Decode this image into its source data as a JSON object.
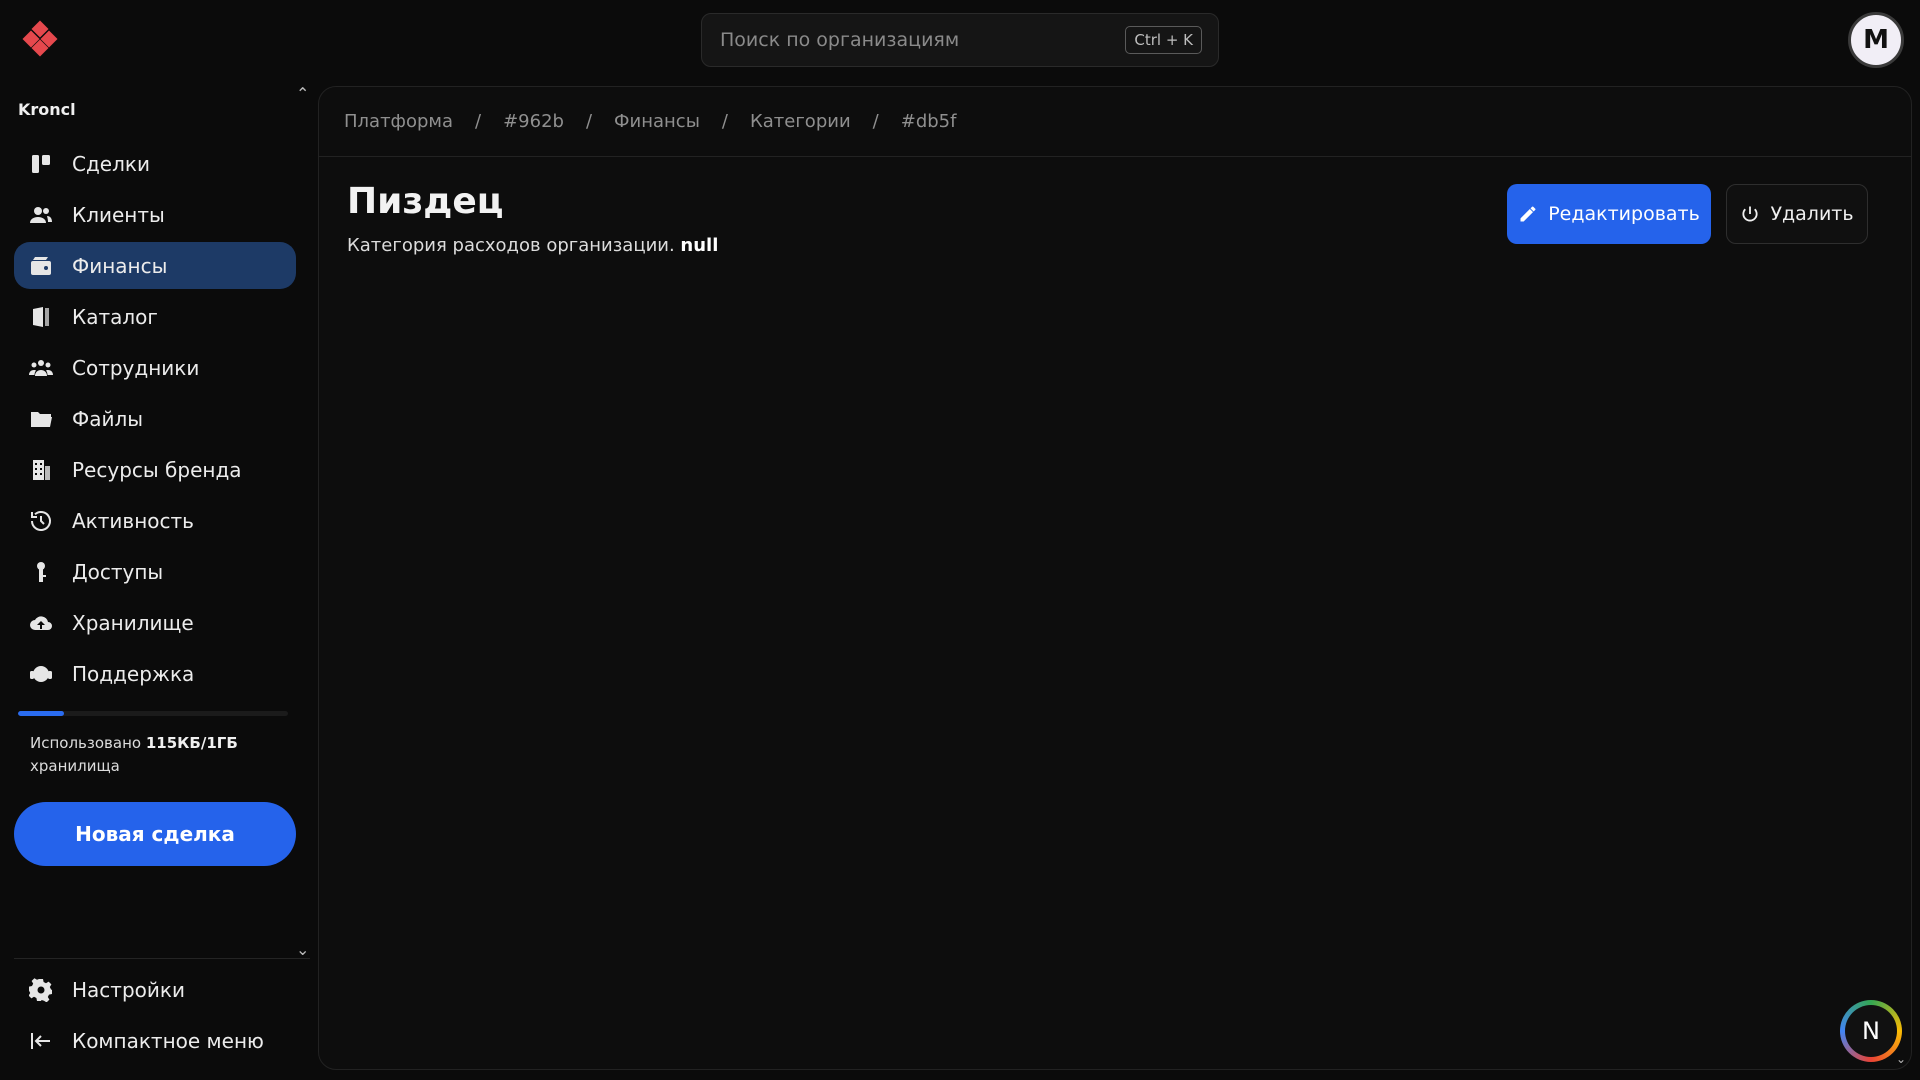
{
  "search": {
    "placeholder": "Поиск по организациям",
    "shortcut": "Ctrl + K"
  },
  "user": {
    "avatar_letter": "M"
  },
  "sidebar": {
    "org_name": "Kroncl",
    "items": [
      {
        "label": "Сделки",
        "icon": "kanban-icon",
        "active": false
      },
      {
        "label": "Клиенты",
        "icon": "users-icon",
        "active": false
      },
      {
        "label": "Финансы",
        "icon": "wallet-icon",
        "active": true
      },
      {
        "label": "Каталог",
        "icon": "catalog-icon",
        "active": false
      },
      {
        "label": "Сотрудники",
        "icon": "team-icon",
        "active": false
      },
      {
        "label": "Файлы",
        "icon": "folder-icon",
        "active": false
      },
      {
        "label": "Ресурсы бренда",
        "icon": "building-icon",
        "active": false
      },
      {
        "label": "Активность",
        "icon": "history-icon",
        "active": false
      },
      {
        "label": "Доступы",
        "icon": "key-icon",
        "active": false
      },
      {
        "label": "Хранилище",
        "icon": "cloud-upload-icon",
        "active": false
      },
      {
        "label": "Поддержка",
        "icon": "headset-icon",
        "active": false
      }
    ],
    "storage": {
      "prefix": "Использовано",
      "amount": "115КБ/1ГБ",
      "suffix": "хранилища",
      "used_fraction": 0.17
    },
    "new_deal_label": "Новая сделка",
    "bottom_items": [
      {
        "label": "Настройки",
        "icon": "gear-icon"
      },
      {
        "label": "Компактное меню",
        "icon": "collapse-left-icon"
      }
    ]
  },
  "breadcrumb": [
    "Платформа",
    "#962b",
    "Финансы",
    "Категории",
    "#db5f"
  ],
  "page": {
    "title": "Пиздец",
    "description": "Категория расходов организации.",
    "description_value": "null"
  },
  "actions": {
    "edit_label": "Редактировать",
    "delete_label": "Удалить"
  },
  "badge": {
    "letter": "N"
  },
  "colors": {
    "accent": "#2563eb",
    "active_nav": "#1d3a66",
    "background": "#0b0b0b",
    "logo": "#e5484d"
  }
}
